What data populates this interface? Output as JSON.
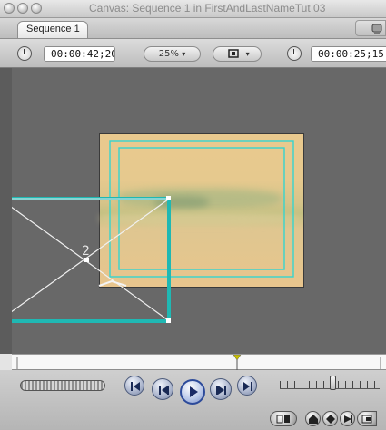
{
  "window": {
    "title": "Canvas: Sequence 1 in FirstAndLastNameTut 03"
  },
  "tabs": [
    {
      "label": "Sequence 1"
    }
  ],
  "controls": {
    "duration_timecode": "00:00:42;20",
    "zoom_label": "25%",
    "view_label": "",
    "current_timecode": "00:00:25;15"
  },
  "viewer": {
    "clip_colors": {
      "image_base": "#e8c58d",
      "safe_area": "#2fd3cf",
      "selection": "#1fb8b3",
      "wireframe": "#f2f2f2"
    },
    "wireframe_label": "2"
  },
  "scrubber": {
    "playhead_position": 0.605,
    "playhead_color": "#c9c000"
  },
  "transport": {
    "icons": [
      "go-to-in-icon",
      "step-back-icon",
      "play-icon",
      "step-forward-icon",
      "go-to-out-icon"
    ],
    "jog_position": 0.55,
    "bottom_icons": [
      "match-frame-icon",
      "add-marker-icon",
      "add-keyframe-icon",
      "mark-in-icon",
      "overwrite-icon"
    ]
  }
}
